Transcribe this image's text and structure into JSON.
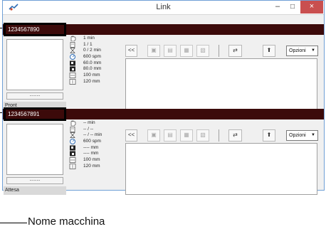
{
  "window": {
    "title": "Link",
    "min_glyph": "–",
    "max_glyph": "□",
    "close_glyph": "×"
  },
  "panels": [
    {
      "machine_name": "1234567890",
      "preview_button": ".........",
      "status": "Pront",
      "info": [
        "1 min",
        "1 / 1",
        "0 / 2 min",
        "600 spm",
        "60.0 mm",
        "80.0 mm",
        "100 mm",
        "120 mm"
      ],
      "toolbar": {
        "collapse": "<<",
        "options_label": "Opzioni"
      }
    },
    {
      "machine_name": "1234567891",
      "preview_button": ".........",
      "status": "Attesa",
      "info": [
        "-- min",
        "-- / --",
        "-- / -- min",
        "600 spm",
        "---- mm",
        "---- mm",
        "100 mm",
        "120 mm"
      ],
      "toolbar": {
        "collapse": "<<",
        "options_label": "Opzioni"
      }
    }
  ],
  "callout": {
    "label": "Nome macchina"
  },
  "icons": [
    "hand-icon",
    "sheets-icon",
    "hourglass-icon",
    "speed-gauge-icon",
    "pattern-icon",
    "pattern-icon",
    "width-icon",
    "height-icon"
  ]
}
